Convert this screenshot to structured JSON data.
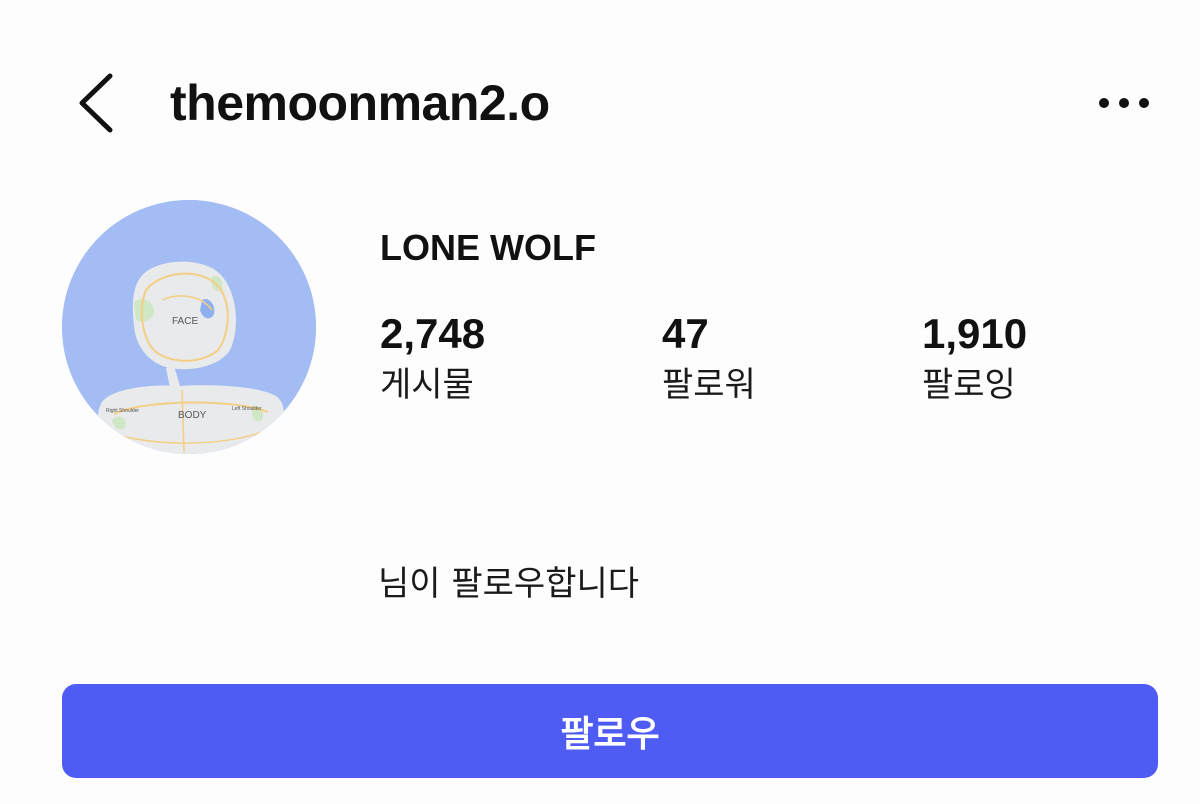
{
  "header": {
    "username": "themoonman2.o",
    "back_icon": "chevron-left-icon",
    "more_icon": "ellipsis-horizontal-icon"
  },
  "profile": {
    "display_name": "LONE WOLF",
    "avatar": {
      "labels": {
        "face": "FACE",
        "body": "BODY",
        "right_shoulder": "Right Shoulder",
        "left_shoulder": "Left Shoulder"
      }
    },
    "stats": [
      {
        "value": "2,748",
        "label": "게시물"
      },
      {
        "value": "47",
        "label": "팔로워"
      },
      {
        "value": "1,910",
        "label": "팔로잉"
      }
    ],
    "follows_you_text": "님이 팔로우합니다"
  },
  "actions": {
    "follow_label": "팔로우"
  },
  "colors": {
    "accent": "#4f5cf4",
    "avatar_water": "#a3bdf4",
    "text": "#111111"
  }
}
